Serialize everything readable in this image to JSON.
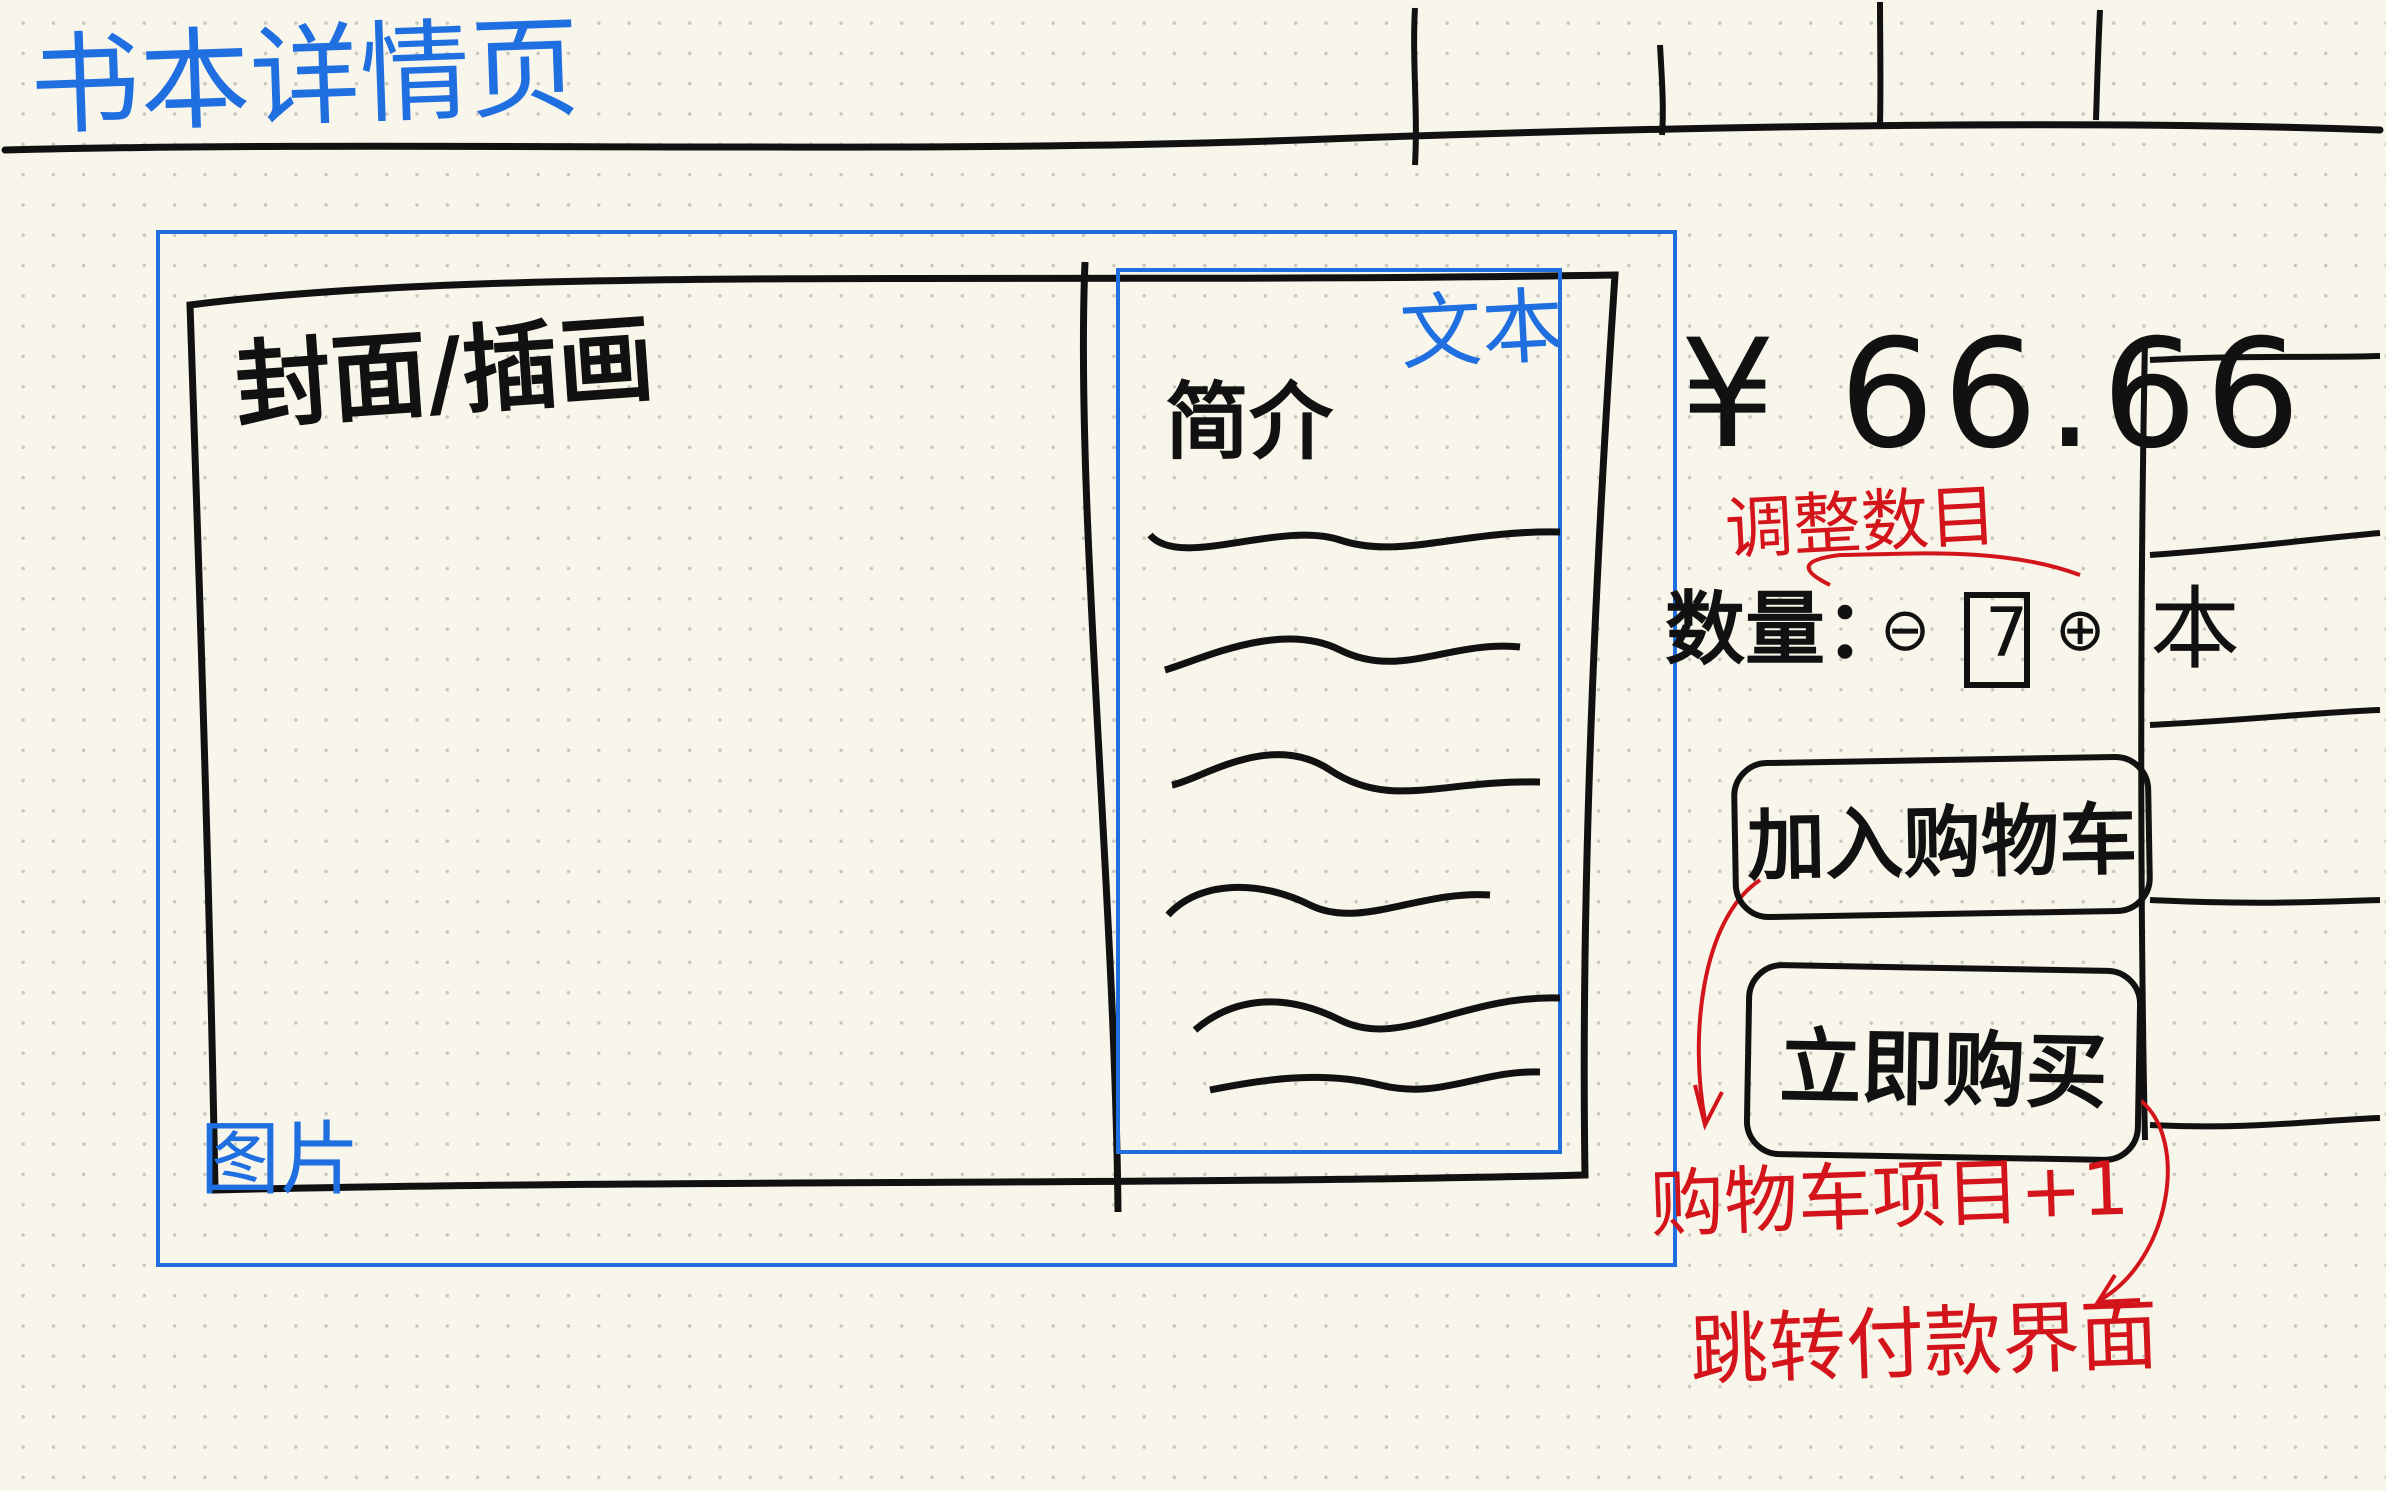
{
  "page": {
    "title": "书本详情页"
  },
  "image_area": {
    "label": "图片",
    "cover_label": "封面/插画"
  },
  "text_area": {
    "label": "文本",
    "intro_label": "简介"
  },
  "price": {
    "text": "¥ 66.66"
  },
  "quantity": {
    "label": "数量：",
    "minus_symbol": "⊖",
    "value": "7",
    "plus_symbol": "⊕",
    "unit": "本",
    "annotation": "调整数目"
  },
  "buttons": {
    "add_to_cart": "加入购物车",
    "buy_now": "立即购买"
  },
  "annotations": {
    "add_to_cart_effect": "购物车项目+1",
    "buy_now_effect": "跳转付款界面"
  },
  "colors": {
    "background": "#f8f6ea",
    "ink": "#111111",
    "annotation_blue": "#1f6fe0",
    "annotation_red": "#d3151b"
  }
}
